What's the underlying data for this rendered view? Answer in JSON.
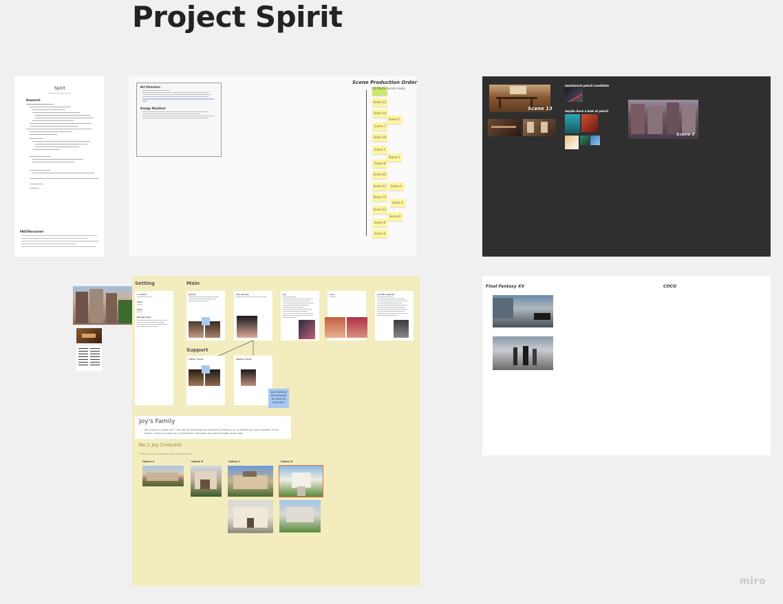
{
  "board": {
    "title": "Project Spirit",
    "logo": "miro"
  },
  "doc_frame": {
    "title": "Spirit",
    "heading": "Research",
    "faq_heading": "FAQ/Discussion"
  },
  "art_frame": {
    "art_direction": "Art Direction",
    "design_manifest": "Design Manifest",
    "scene_order_title": "Scene Production Order",
    "green_note": "Art Master assets ready",
    "scenes_main": [
      "Scene 13",
      "Scene 14",
      "Scene 7",
      "Scene 16",
      "Scene 1",
      "Scene 8",
      "Scene 10",
      "Scene 11",
      "Scene 15",
      "Scene 12",
      "Scene 6",
      "Scene 9"
    ],
    "scenes_side": [
      "Scene 5",
      "Scene 3",
      "Scene 4",
      "Scene 2",
      "Scene 9"
    ]
  },
  "dark_frame": {
    "scene13_label": "Scene 13",
    "scene3_label": "Scene 3",
    "mechanical_label": "mechanical pencil candidate",
    "maybe_label": "maybe have a look at pencil"
  },
  "yellow_frame": {
    "setting": "Setting",
    "main": "Main",
    "support": "Support",
    "setting_card": [
      "Location",
      "Time",
      "Date",
      "Background"
    ],
    "main_cards": [
      "Jewell",
      "Sea Sparks",
      "Joy",
      "Lucy",
      "Lynette Sparks"
    ],
    "support_cards": [
      "Father Yusuf",
      "Mother Yusuf"
    ],
    "blue_note": "Just choosing the template for these to save time",
    "joy_family_title": "Joy's Family",
    "joy_family_text": "Joy's family is super rich. They will be providing the necessary funding (e.g. on tickets) for Lisa's solution of the travels. They thus play the \"conventions\" role when we need to break some rules",
    "crescent_title": "No.1 Joy Crescent",
    "crescent_sub": "This is the kind of house Joy's family lives in",
    "options": [
      "Option A",
      "Option B",
      "Option C",
      "Option D"
    ]
  },
  "ref_frame": {
    "ff_title": "Final Fantasy XV",
    "coco_title": "COCO"
  },
  "colors": {
    "sticky": "#fff59d",
    "sticky_green": "#cce86a",
    "yellow_frame": "#f3ecbf",
    "dark_frame": "#2f2f2f",
    "blue_sticky": "#a7c8f0"
  }
}
